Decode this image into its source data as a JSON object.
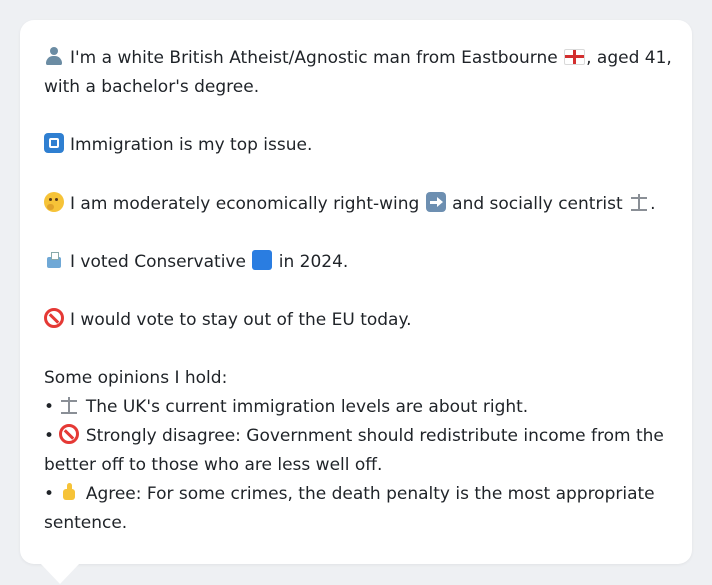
{
  "profile": {
    "identity_line1": "I'm a white British Atheist/Agnostic man from Eastbourne",
    "identity_line1_tail": ", aged 41,",
    "identity_line2": "with a bachelor's degree.",
    "top_issue": "Immigration is my top issue.",
    "economic_text": "I am moderately economically right-wing",
    "social_text": "and socially centrist",
    "social_tail": ".",
    "vote_prefix": "I voted Conservative",
    "vote_suffix": "in 2024.",
    "eu_text": "I would vote to stay out of the EU today."
  },
  "opinions": {
    "heading": "Some opinions I hold:",
    "bullet_char": "•",
    "items": [
      {
        "icon": "scales-icon",
        "line1": "The UK's current immigration levels are about right.",
        "line2": ""
      },
      {
        "icon": "prohibited-icon",
        "line1": "Strongly disagree: Government should redistribute income from the",
        "line2": "better off to those who are less well off."
      },
      {
        "icon": "thumbs-up-icon",
        "line1": "Agree: For some crimes, the death penalty is the most appropriate",
        "line2": "sentence."
      }
    ]
  },
  "colors": {
    "card_background": "#ffffff",
    "page_background": "#eef0f3",
    "text": "#1f2328"
  }
}
